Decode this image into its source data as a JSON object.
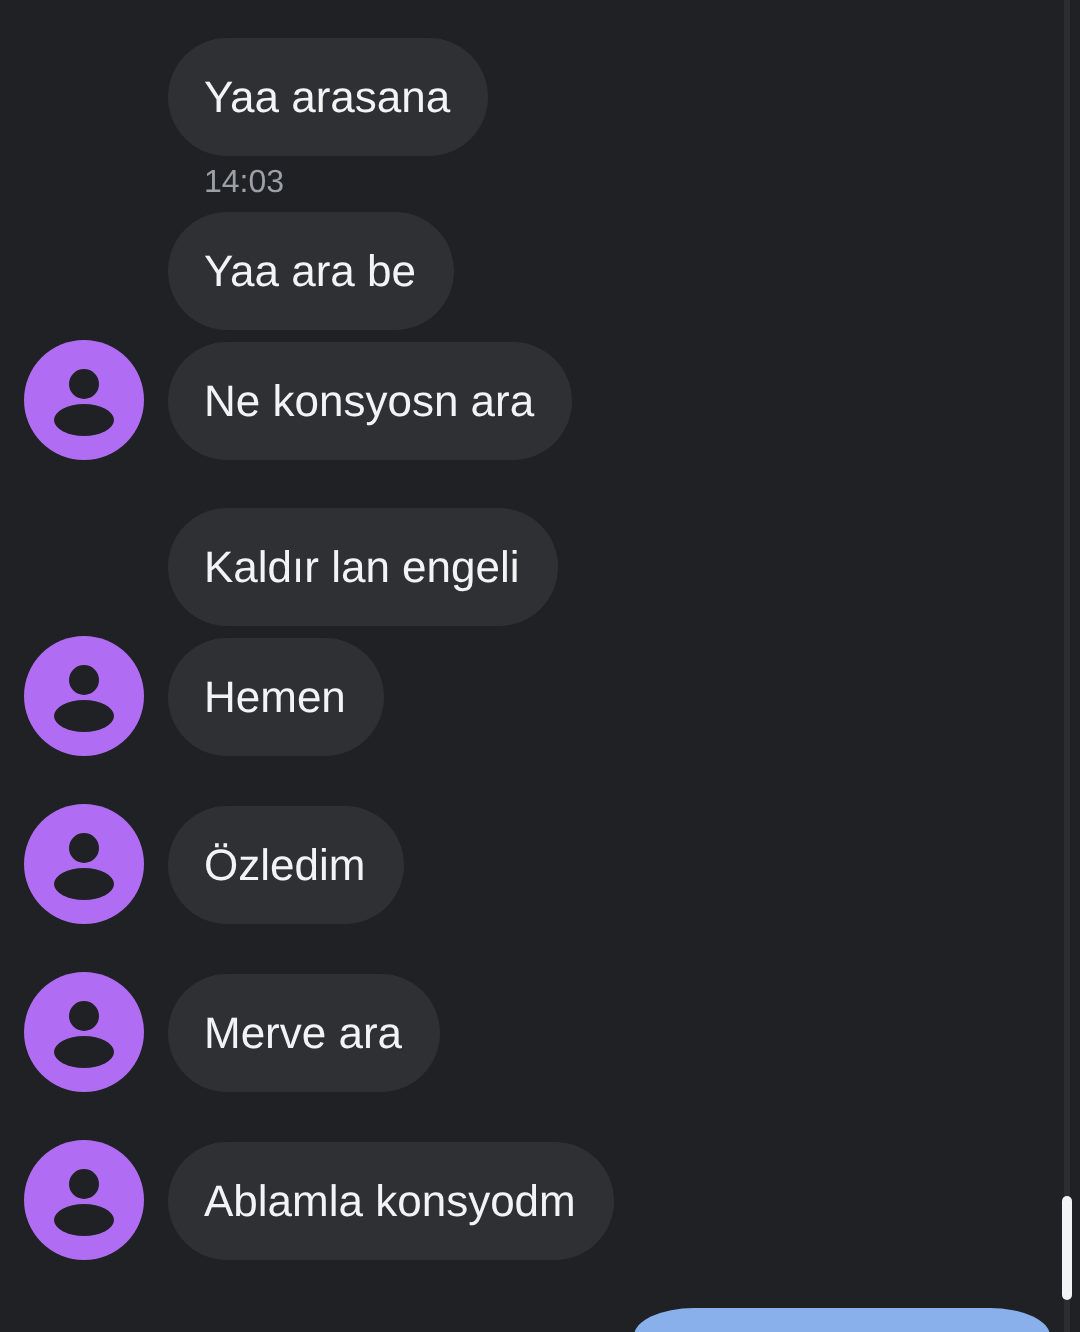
{
  "groups": [
    {
      "items": [
        {
          "kind": "message",
          "text": "Yaa arasana",
          "avatar": false
        },
        {
          "kind": "timestamp",
          "text": "14:03"
        },
        {
          "kind": "message",
          "text": "Yaa ara be",
          "avatar": false
        },
        {
          "kind": "message",
          "text": "Ne konsyosn ara",
          "avatar": true
        }
      ]
    },
    {
      "items": [
        {
          "kind": "message",
          "text": "Kaldır lan engeli",
          "avatar": false
        },
        {
          "kind": "message",
          "text": "Hemen",
          "avatar": true
        }
      ]
    },
    {
      "items": [
        {
          "kind": "message",
          "text": "Özledim",
          "avatar": true
        }
      ]
    },
    {
      "items": [
        {
          "kind": "message",
          "text": "Merve ara",
          "avatar": true
        }
      ]
    },
    {
      "items": [
        {
          "kind": "message",
          "text": "Ablamla konsyodm",
          "avatar": true
        }
      ]
    },
    {
      "items": [
        {
          "kind": "outgoing"
        }
      ]
    }
  ]
}
